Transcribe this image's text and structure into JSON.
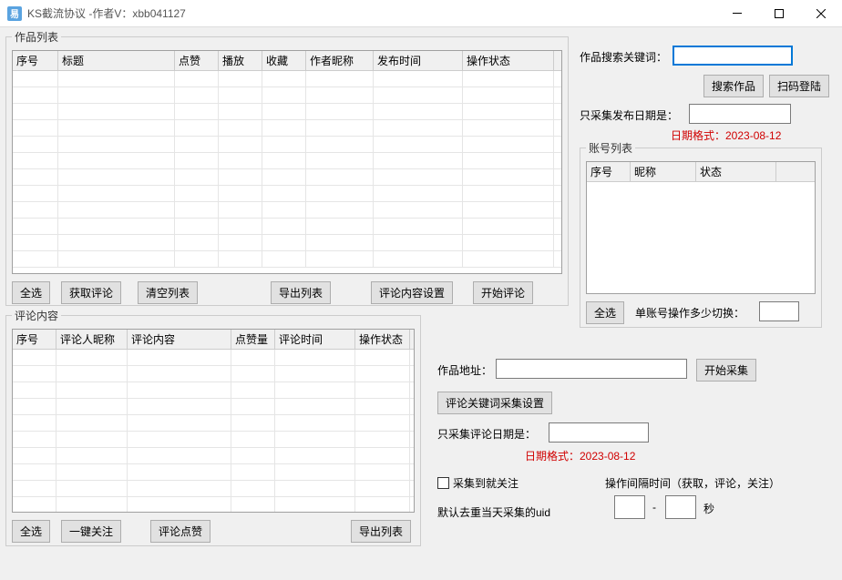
{
  "window": {
    "title": "KS截流协议 -作者V：xbb041127",
    "icon_text": "易"
  },
  "works_group": {
    "title": "作品列表",
    "columns": [
      "序号",
      "标题",
      "点赞",
      "播放",
      "收藏",
      "作者昵称",
      "发布时间",
      "操作状态"
    ],
    "buttons": {
      "select_all": "全选",
      "get_comments": "获取评论",
      "clear_list": "清空列表",
      "export_list": "导出列表",
      "comment_content_settings": "评论内容设置",
      "start_comment": "开始评论"
    }
  },
  "comments_group": {
    "title": "评论内容",
    "columns": [
      "序号",
      "评论人昵称",
      "评论内容",
      "点赞量",
      "评论时间",
      "操作状态"
    ],
    "buttons": {
      "select_all": "全选",
      "one_click_follow": "一键关注",
      "comment_like": "评论点赞",
      "export_list": "导出列表"
    }
  },
  "right": {
    "search_label": "作品搜索关键词：",
    "search_value": "",
    "search_btn": "搜索作品",
    "scan_login_btn": "扫码登陆",
    "pub_date_label": "只采集发布日期是：",
    "pub_date_value": "",
    "date_format_hint": "日期格式：2023-08-12",
    "accounts_group": {
      "title": "账号列表",
      "columns": [
        "序号",
        "昵称",
        "状态"
      ],
      "select_all": "全选",
      "single_acct_switch_label": "单账号操作多少切换：",
      "single_acct_switch_value": ""
    }
  },
  "bottom_right": {
    "work_url_label": "作品地址：",
    "work_url_value": "",
    "start_collect_btn": "开始采集",
    "comment_kw_settings_btn": "评论关键词采集设置",
    "comment_date_label": "只采集评论日期是：",
    "comment_date_value": "",
    "date_format_hint": "日期格式：2023-08-12",
    "follow_on_collect": "采集到就关注",
    "interval_label": "操作间隔时间（获取，评论，关注）",
    "interval_min": "",
    "interval_sep": "-",
    "interval_max": "",
    "interval_unit": "秒",
    "default_hint": "默认去重当天采集的uid"
  }
}
